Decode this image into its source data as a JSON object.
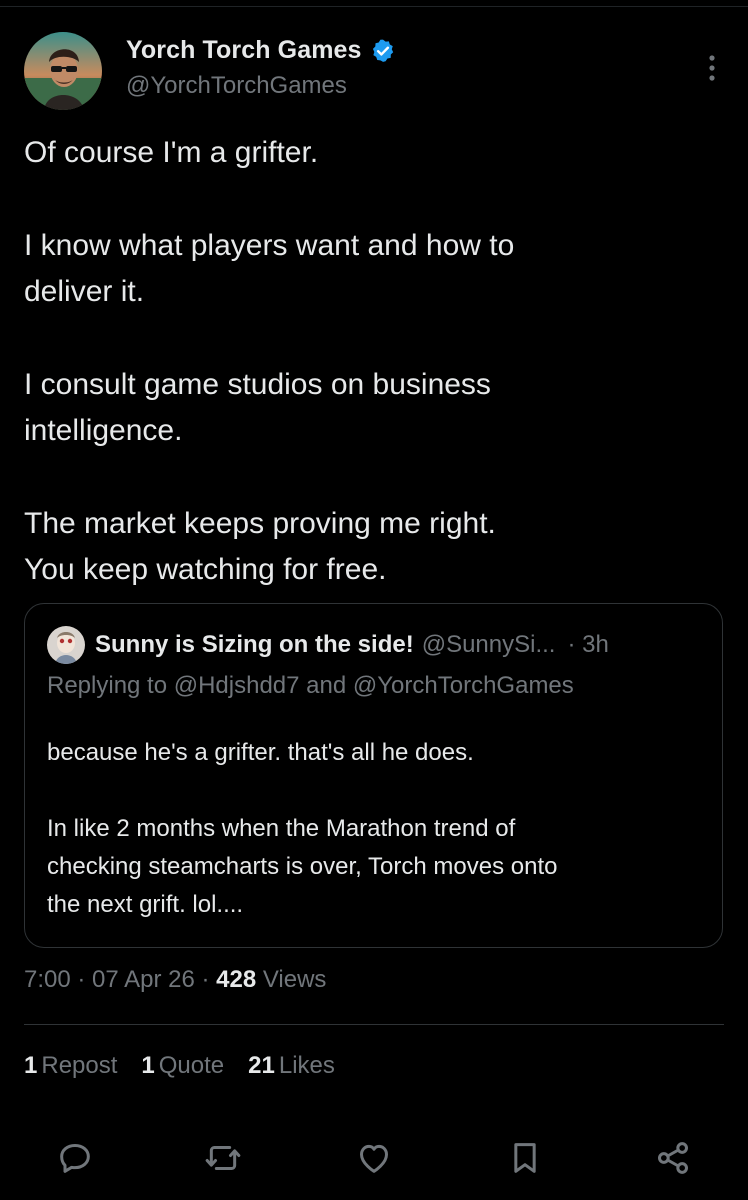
{
  "author": {
    "display_name": "Yorch Torch Games",
    "handle": "@YorchTorchGames",
    "verified_icon": "verified-badge-icon",
    "verified_color": "#1d9bf0"
  },
  "tweet": {
    "paragraphs": [
      [
        "Of course I'm a grifter."
      ],
      [
        "I know what players want and how to",
        "deliver it."
      ],
      [
        "I consult game studios on business",
        "intelligence."
      ],
      [
        "The market keeps proving me right.",
        "You keep watching for free."
      ]
    ]
  },
  "quote": {
    "display_name": "Sunny is Sizing on the side!",
    "handle": "@SunnySi...",
    "time": "· 3h",
    "replying_to": "Replying to @Hdjshdd7 and @YorchTorchGames",
    "paragraphs": [
      [
        "because he's a grifter. that's all he does."
      ],
      [
        "In like 2 months when the Marathon trend of",
        "checking steamcharts is over, Torch moves onto",
        "the next grift. lol...."
      ]
    ]
  },
  "meta": {
    "time": "7:00",
    "sep1": " · ",
    "date": "07 Apr 26",
    "sep2": " · ",
    "views_count": "428",
    "views_label": " Views"
  },
  "stats": [
    {
      "count": "1",
      "label": "Repost"
    },
    {
      "count": "1",
      "label": "Quote"
    },
    {
      "count": "21",
      "label": "Likes"
    }
  ],
  "actions": [
    {
      "icon": "reply-icon"
    },
    {
      "icon": "repost-icon"
    },
    {
      "icon": "like-icon"
    },
    {
      "icon": "bookmark-icon"
    },
    {
      "icon": "share-icon"
    }
  ],
  "colors": {
    "background": "#000000",
    "text": "#e7e9ea",
    "muted": "#71767b",
    "border": "#2f3336",
    "accent": "#1d9bf0"
  }
}
